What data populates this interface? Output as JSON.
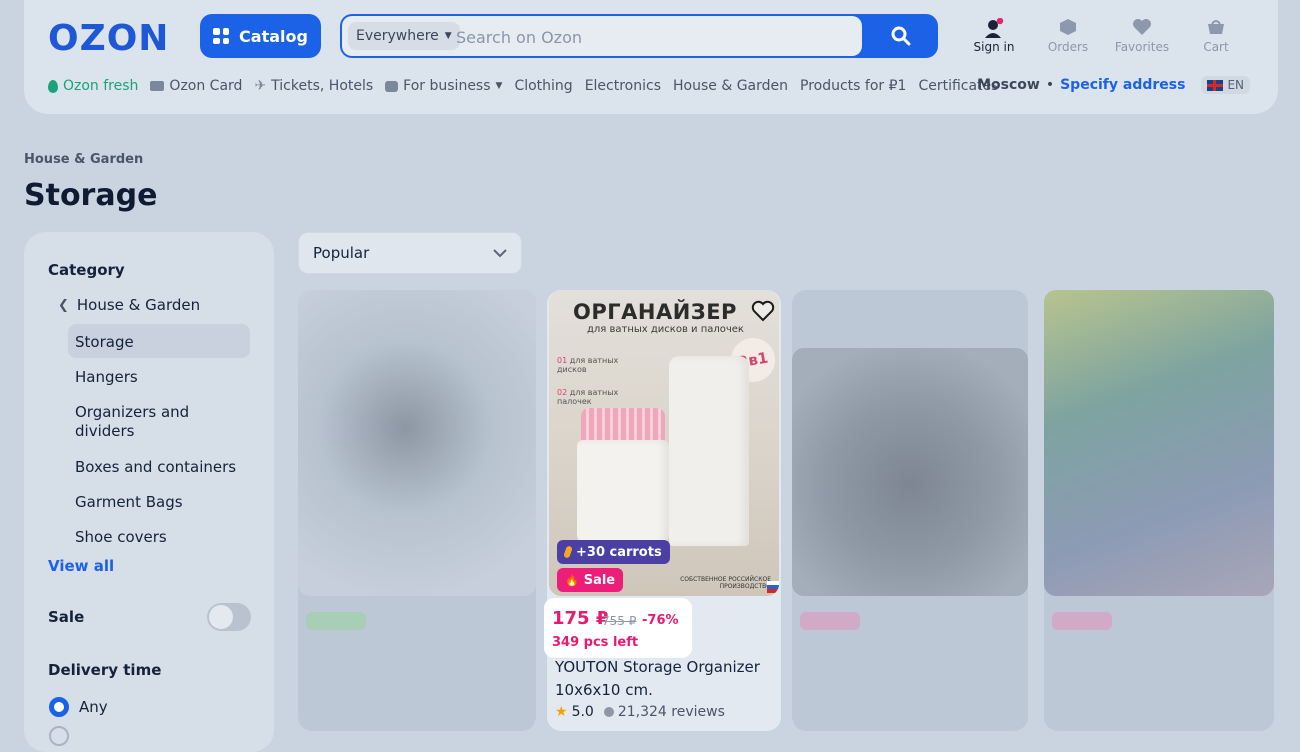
{
  "header": {
    "logo": "OZON",
    "catalog_label": "Catalog",
    "search_scope": "Everywhere",
    "search_placeholder": "Search on Ozon",
    "actions": {
      "signin": "Sign in",
      "orders": "Orders",
      "favorites": "Favorites",
      "cart": "Cart"
    }
  },
  "nav": {
    "items": [
      "Ozon fresh",
      "Ozon Card",
      "Tickets, Hotels",
      "For business",
      "Clothing",
      "Electronics",
      "House & Garden",
      "Products for ₽1",
      "Certificates"
    ]
  },
  "location": {
    "city": "Moscow",
    "specify": "Specify address",
    "lang": "EN"
  },
  "breadcrumb": "House & Garden",
  "page_title": "Storage",
  "sidebar": {
    "category_heading": "Category",
    "parent": "House & Garden",
    "items": [
      "Storage",
      "Hangers",
      "Organizers and dividers",
      "Boxes and containers",
      "Garment Bags",
      "Shoe covers"
    ],
    "view_all": "View all",
    "sale_label": "Sale",
    "delivery_heading": "Delivery time",
    "delivery_option": "Any"
  },
  "sort": {
    "selected": "Popular"
  },
  "product": {
    "image_title": "ОРГАНАЙЗЕР",
    "image_subtitle": "для ватных дисков и палочек",
    "image_note_1_num": "01",
    "image_note_1": "для ватных дисков",
    "image_note_2_num": "02",
    "image_note_2": "для ватных палочек",
    "image_badge": "2в1",
    "image_origin": "СОБСТВЕННОЕ РОССИЙСКОЕ ПРОИЗВОДСТВО",
    "carrots": "+30 carrots",
    "sale": "Sale",
    "price": "175 ₽",
    "old_price": "755 ₽",
    "discount": "-76%",
    "stock": "349 pcs left",
    "name": "YOUTON Storage Organizer 10x6x10 cm.",
    "rating": "5.0",
    "reviews": "21,324 reviews",
    "colors": {
      "accent": "#1c62e6",
      "sale": "#ed1e79",
      "carrots": "#4b3fa3"
    }
  }
}
